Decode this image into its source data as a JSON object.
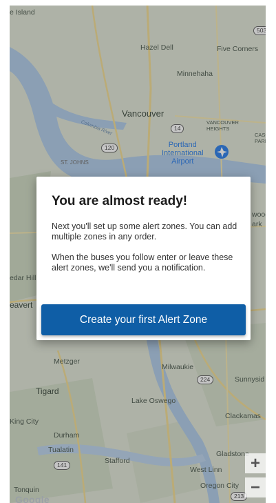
{
  "map": {
    "places": {
      "island": "e Island",
      "hazel_dell": "Hazel Dell",
      "five_corners": "Five Corners",
      "minnehaha": "Minnehaha",
      "vancouver": "Vancouver",
      "vancouver_heights": "VANCOUVER\nHEIGHTS",
      "casc_park": "CASC\nPARK",
      "st_johns": "ST. JOHNS",
      "columbia_river": "Columbia River",
      "wood_park": "wood\nark",
      "cedar_hill": "edar Hill",
      "beaverton": "eavert",
      "metzger": "Metzger",
      "milwaukie": "Milwaukie",
      "sunnyside": "Sunnysid",
      "tigard": "Tigard",
      "lake_oswego": "Lake Oswego",
      "king_city": "King City",
      "clackamas": "Clackamas",
      "durham": "Durham",
      "tualatin": "Tualatin",
      "stafford": "Stafford",
      "gladstone": "Gladstone",
      "west_linn": "West Linn",
      "tonquin": "Tonquin",
      "oregon_city": "Oregon City"
    },
    "airport_label": "Portland\nInternational\nAirport",
    "shields": {
      "r503": "503",
      "r14": "14",
      "r120": "120",
      "r224": "224",
      "r141": "141",
      "r213": "213"
    },
    "zoom_in": "+",
    "zoom_out": "−",
    "attribution": "Google"
  },
  "dialog": {
    "title": "You are almost ready!",
    "body1": "Next you'll set up some alert zones. You can add multiple zones in any order.",
    "body2": "When the buses you follow enter or leave these alert zones, we'll send you a notification.",
    "cta": "Create your first Alert Zone"
  },
  "colors": {
    "accent": "#0f5ea6",
    "map_land": "#dde3d2",
    "water": "#a9c7e6"
  }
}
